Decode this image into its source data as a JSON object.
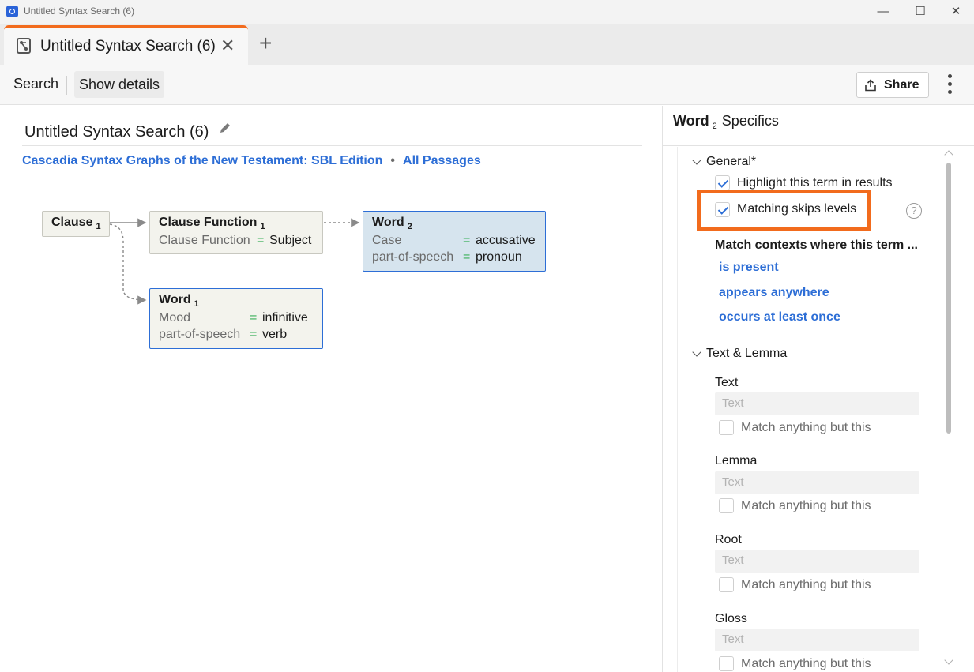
{
  "window": {
    "title": "Untitled Syntax Search (6)",
    "minimize": "—",
    "maximize": "☐",
    "close": "✕"
  },
  "tabs": {
    "active_label": "Untitled Syntax Search (6)",
    "close": "✕",
    "add": "+"
  },
  "toolbar": {
    "search_label": "Search",
    "details_label": "Show details",
    "share_label": "Share"
  },
  "main": {
    "title": "Untitled Syntax Search (6)",
    "resource_link": "Cascadia Syntax Graphs of the New Testament: SBL Edition",
    "separator": "•",
    "passages_link": "All Passages",
    "nodes": {
      "clause": {
        "title": "Clause",
        "index": "1"
      },
      "clause_function": {
        "title": "Clause Function",
        "index": "1",
        "rows": [
          {
            "key": "Clause Function",
            "eq": "=",
            "value": "Subject"
          }
        ]
      },
      "word2": {
        "title": "Word",
        "index": "2",
        "rows": [
          {
            "key": "Case",
            "eq": "=",
            "value": "accusative"
          },
          {
            "key": "part-of-speech",
            "eq": "=",
            "value": "pronoun"
          }
        ]
      },
      "word1": {
        "title": "Word",
        "index": "1",
        "rows": [
          {
            "key": "Mood",
            "eq": "=",
            "value": "infinitive"
          },
          {
            "key": "part-of-speech",
            "eq": "=",
            "value": "verb"
          }
        ]
      }
    }
  },
  "panel": {
    "title_word": "Word",
    "title_index": "2",
    "title_rest": "Specifics",
    "general": {
      "header": "General*",
      "highlight_label": "Highlight this term in results",
      "highlight_checked": true,
      "skips_label": "Matching skips levels",
      "skips_checked": true,
      "help": "?"
    },
    "contexts": {
      "header": "Match contexts where this term ...",
      "options": [
        "is present",
        "appears anywhere",
        "occurs at least once"
      ]
    },
    "text_lemma": {
      "header": "Text & Lemma",
      "fields": [
        {
          "label": "Text",
          "placeholder": "Text",
          "negate_label": "Match anything but this"
        },
        {
          "label": "Lemma",
          "placeholder": "Text",
          "negate_label": "Match anything but this"
        },
        {
          "label": "Root",
          "placeholder": "Text",
          "negate_label": "Match anything but this"
        },
        {
          "label": "Gloss",
          "placeholder": "Text",
          "negate_label": "Match anything but this"
        }
      ]
    }
  },
  "colors": {
    "accent_orange": "#f26b1d",
    "link_blue": "#2d6ed6",
    "equals_green": "#3bb05b",
    "selected_node": "#d6e4ee"
  }
}
